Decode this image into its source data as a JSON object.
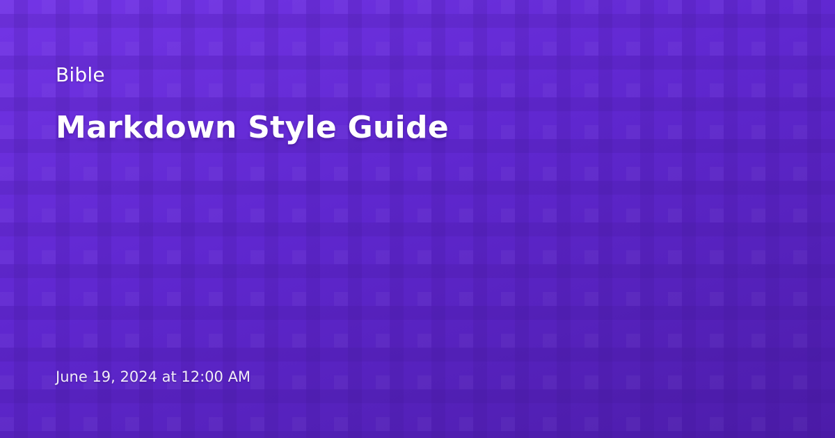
{
  "colors": {
    "background_start": "#7335e6",
    "background_mid": "#5f27cf",
    "background_end": "#4c1ca9",
    "text": "#ffffff"
  },
  "card": {
    "site_name": "Bible",
    "title": "Markdown Style Guide",
    "date": "June 19, 2024 at 12:00 AM"
  }
}
